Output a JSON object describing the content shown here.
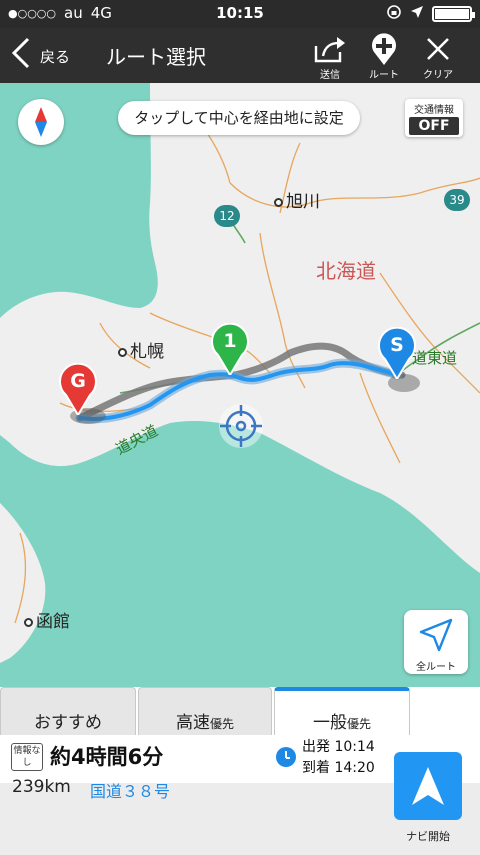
{
  "status_bar": {
    "signal": "●○○○○",
    "carrier": "au",
    "network": "4G",
    "time": "10:15"
  },
  "nav": {
    "back_label": "戻る",
    "title": "ルート選択",
    "send_label": "送信",
    "route_label": "ルート",
    "clear_label": "クリア"
  },
  "map": {
    "hint": "タップして中心を経由地に設定",
    "traffic_title": "交通情報",
    "traffic_state": "OFF",
    "labels": {
      "asahikawa": "旭川",
      "hokkaido": "北海道",
      "sapporo": "札幌",
      "hakodate": "函館",
      "doto": "道東道",
      "dochuo": "道央道"
    },
    "shields": {
      "r12": "12",
      "r39": "39"
    },
    "markers": {
      "goal": "G",
      "via": "1",
      "start": "S"
    },
    "all_route_label": "全ルート"
  },
  "tabs": [
    {
      "label": "おすすめ",
      "suffix": ""
    },
    {
      "label": "高速",
      "suffix": "優先"
    },
    {
      "label": "一般",
      "suffix": "優先"
    }
  ],
  "info": {
    "badge": "情報なし",
    "duration": "約4時間6分",
    "depart": "出発 10:14",
    "arrive": "到着 14:20",
    "distance": "239km",
    "road": "国道３８号",
    "navi_label": "ナビ開始"
  },
  "colors": {
    "sea": "#7fd3c3",
    "land": "#efefef",
    "route": "#2196f3",
    "accent": "#1e88e5"
  }
}
